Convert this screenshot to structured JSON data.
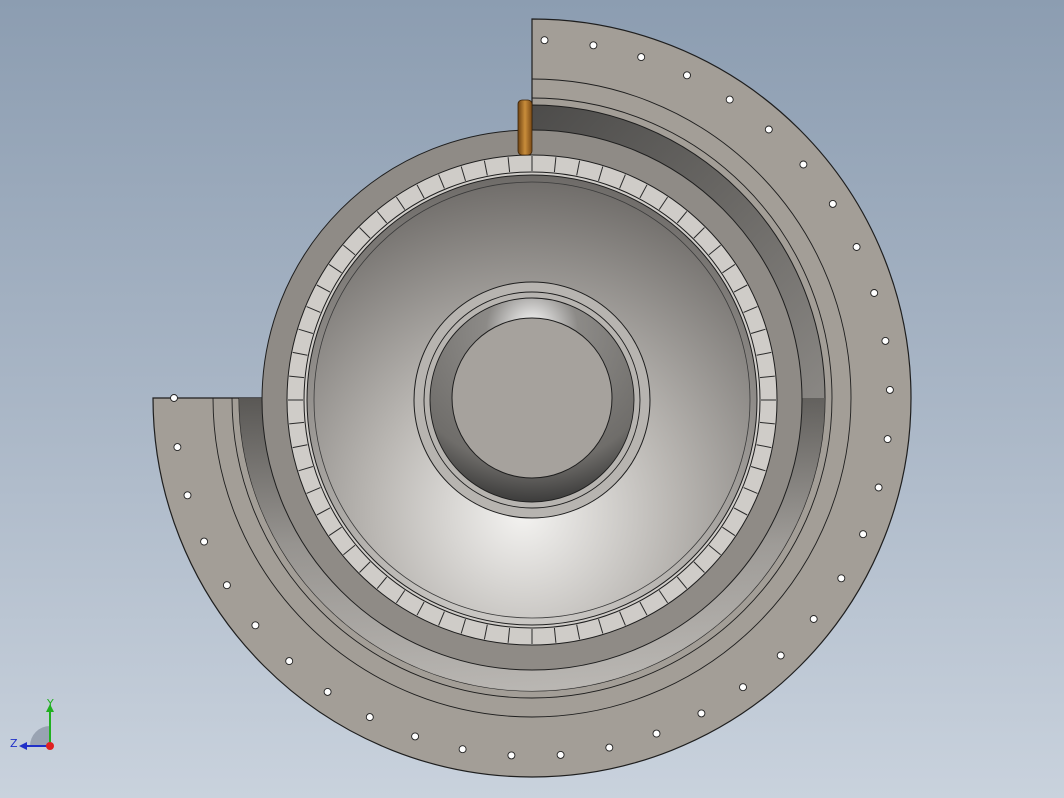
{
  "viewport": {
    "background_top": "#8c9db1",
    "background_bottom": "#c9d2dd"
  },
  "model": {
    "flange_color": "#a39e97",
    "liner_color": "#8a8681",
    "chamber_color": "#9c9893",
    "hub_color": "#a6a29d",
    "fitting_color": "#b27a2e",
    "edge_color": "#1e1e1e"
  },
  "triad": {
    "x_label": "",
    "y_label": "Y",
    "z_label": "Z",
    "x_color": "#e02020",
    "y_color": "#20b020",
    "z_color": "#2030c8"
  }
}
